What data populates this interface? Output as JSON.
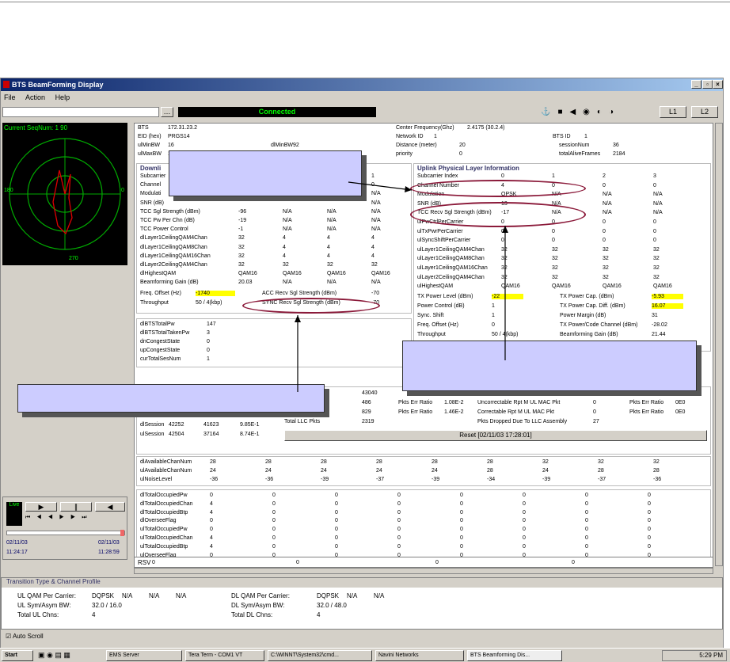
{
  "window": {
    "title": "BTS BeamForming Display",
    "menu": [
      "File",
      "Action",
      "Help"
    ]
  },
  "toolbar": {
    "status": "Connected",
    "l1": "L1",
    "l2": "L2"
  },
  "radar": {
    "seqnum": "Current SeqNum: 1 90",
    "left": "180",
    "right": "0",
    "bottom": "270"
  },
  "header": {
    "bts_label": "BTS",
    "bts": "172.31.23.2",
    "eid_label": "EID (hex)",
    "eid": "PRGS14",
    "ulmin_label": "ulMinBW",
    "ulmin": "16",
    "dlmin_label": "dlMinBW",
    "dlmin": "92",
    "ulmax_label": "ulMaxBW",
    "ulmax": "16",
    "cf_label": "Center Frequency(Ghz)",
    "cf": "2.4175 (30.2.4)",
    "net_label": "Network ID",
    "net": "1",
    "btsid_label": "BTS ID",
    "btsid": "1",
    "dist_label": "Distance (meter)",
    "dist": "20",
    "prio_label": "priority",
    "prio": "0",
    "sess_label": "sessionNum",
    "sess": "36",
    "frames_label": "totalAliveFrames",
    "frames": "2184"
  },
  "downlink": {
    "title": "Downli",
    "rows": [
      {
        "label": "Subcarrier",
        "vals": [
          "",
          "",
          "",
          "1"
        ]
      },
      {
        "label": "Channel",
        "vals": [
          "",
          "",
          "",
          "0"
        ]
      },
      {
        "label": "Modulati",
        "vals": [
          "",
          "",
          "",
          "N/A"
        ]
      },
      {
        "label": "SNR (dB)",
        "vals": [
          "",
          "",
          "",
          "N/A"
        ]
      },
      {
        "label": "TCC Sgl Strength (dBm)",
        "vals": [
          "-96",
          "N/A",
          "N/A",
          "N/A"
        ]
      },
      {
        "label": "TCC Pw Per Chn (dB)",
        "vals": [
          "-19",
          "N/A",
          "N/A",
          "N/A"
        ]
      },
      {
        "label": "TCC Power Control",
        "vals": [
          "-1",
          "N/A",
          "N/A",
          "N/A"
        ]
      },
      {
        "label": "dlLayer1CeilingQAM4Chan",
        "vals": [
          "32",
          "4",
          "4",
          "4"
        ]
      },
      {
        "label": "dlLayer1CeilingQAM8Chan",
        "vals": [
          "32",
          "4",
          "4",
          "4"
        ]
      },
      {
        "label": "dlLayer1CeilingQAM16Chan",
        "vals": [
          "32",
          "4",
          "4",
          "4"
        ]
      },
      {
        "label": "dlLayer2CeilingQAM4Chan",
        "vals": [
          "32",
          "32",
          "32",
          "32"
        ]
      },
      {
        "label": "dlHighestQAM",
        "vals": [
          "QAM16",
          "QAM16",
          "QAM16",
          "QAM16"
        ]
      },
      {
        "label": "Beamforming Gain (dB)",
        "vals": [
          "20.03",
          "N/A",
          "N/A",
          "N/A"
        ]
      }
    ],
    "freq_label": "Freq. Offset (Hz)",
    "freq": "-1740",
    "acc_label": "ACC Recv Sgl Strength (dBm)",
    "acc": "-70",
    "thr_label": "Throughput",
    "thr": "50 / 4(kbp)",
    "sync_label": "SYNC Recv Sgl Strength (dBm)",
    "sync": "-70"
  },
  "uplink": {
    "title": "Uplink Physical Layer Information",
    "rows": [
      {
        "label": "Subcarrier Index",
        "vals": [
          "0",
          "1",
          "2",
          "3"
        ]
      },
      {
        "label": "Channel Number",
        "vals": [
          "4",
          "0",
          "0",
          "0"
        ]
      },
      {
        "label": "Modulation",
        "vals": [
          "QPSK",
          "N/A",
          "N/A",
          "N/A"
        ]
      },
      {
        "label": "SNR (dB)",
        "vals": [
          "13",
          "N/A",
          "N/A",
          "N/A"
        ]
      },
      {
        "label": "TCC Recv Sgl Strength (dBm)",
        "vals": [
          "-17",
          "N/A",
          "N/A",
          "N/A"
        ]
      },
      {
        "label": "ulPwCtrlPerCarrier",
        "vals": [
          "0",
          "0",
          "0",
          "0"
        ]
      },
      {
        "label": "ulTxPwrPerCarrier",
        "vals": [
          "0",
          "0",
          "0",
          "0"
        ]
      },
      {
        "label": "ulSyncShiftPerCarrier",
        "vals": [
          "0",
          "0",
          "0",
          "0"
        ]
      },
      {
        "label": "ulLayer1CeilingQAM4Chan",
        "vals": [
          "32",
          "32",
          "32",
          "32"
        ]
      },
      {
        "label": "ulLayer1CeilingQAM8Chan",
        "vals": [
          "32",
          "32",
          "32",
          "32"
        ]
      },
      {
        "label": "ulLayer1CeilingQAM16Chan",
        "vals": [
          "32",
          "32",
          "32",
          "32"
        ]
      },
      {
        "label": "ulLayer2CeilingQAM4Chan",
        "vals": [
          "32",
          "32",
          "32",
          "32"
        ]
      },
      {
        "label": "ulHighestQAM",
        "vals": [
          "QAM16",
          "QAM16",
          "QAM16",
          "QAM16"
        ]
      }
    ],
    "tx_label": "TX Power Level (dBm)",
    "tx": "-22",
    "txcap_label": "TX Power Cap. (dBm)",
    "txcap": "-5.93",
    "pc_label": "Power Control (dB)",
    "pc": "1",
    "txdiff_label": "TX Power Cap. Diff. (dBm)",
    "txdiff": "16.07",
    "sync_label": "Sync. Shift",
    "sync": "1",
    "pm_label": "Power Margin (dB)",
    "pm": "31",
    "freq_label": "Freq. Offset (Hz)",
    "freq": "0",
    "tpc_label": "TX Power/Code Channel (dBm)",
    "tpc": "-28.02",
    "thr_label": "Throughput",
    "thr": "50 / 4(kbp)",
    "bg_label": "Beamforming Gain (dB)",
    "bg": "21.44"
  },
  "stats": [
    {
      "label": "dlBTSTotalPw",
      "val": "147"
    },
    {
      "label": "dlBTSTotalTakenPw",
      "val": "3"
    },
    {
      "label": "dnCongestState",
      "val": "0"
    },
    {
      "label": "upCongestState",
      "val": "0"
    },
    {
      "label": "curTotalSesNum",
      "val": "1"
    }
  ],
  "mac": {
    "v1": "43040",
    "v2": "486",
    "v3": "829",
    "v4": "2319",
    "pe1_label": "Pkts Err Ratio",
    "pe1": "1.08E-2",
    "pe2_label": "Pkts Err Ratio",
    "pe2": "1.46E-2",
    "un_label": "Uncorrectable Rpt M UL MAC Pkt",
    "un": "0",
    "co_label": "Correctable Rpt M UL MAC Pkt",
    "co": "0",
    "pd_label": "Pkts Dropped Due To LLC Assembly",
    "pd": "27",
    "pe3_label": "Pkts Err Ratio",
    "pe3": "0E0",
    "pe4_label": "Pkts Err Ratio",
    "pe4": "0E0",
    "llc_label": "Total LLC Pkts",
    "dls_label": "dlSession",
    "dls": [
      "42252",
      "41623",
      "9.85E-1"
    ],
    "uls_label": "ulSession",
    "uls": [
      "42504",
      "37164",
      "8.74E-1"
    ],
    "reset": "Reset [02/11/03 17:28:01]"
  },
  "avail": [
    {
      "label": "dlAvailableChanNum",
      "vals": [
        "28",
        "28",
        "28",
        "28",
        "28",
        "28",
        "32",
        "32",
        "32"
      ]
    },
    {
      "label": "ulAvailableChanNum",
      "vals": [
        "24",
        "24",
        "24",
        "24",
        "24",
        "28",
        "24",
        "28",
        "28"
      ]
    },
    {
      "label": "ulNoiseLevel",
      "vals": [
        "-36",
        "-36",
        "-39",
        "-37",
        "-39",
        "-34",
        "-39",
        "-37",
        "-36"
      ]
    }
  ],
  "occ": [
    {
      "label": "dlTotalOccupiedPw",
      "vals": [
        "0",
        "0",
        "0",
        "0",
        "0",
        "0",
        "0",
        "0"
      ]
    },
    {
      "label": "dlTotalOccupiedChan",
      "vals": [
        "4",
        "0",
        "0",
        "0",
        "0",
        "0",
        "0",
        "0"
      ]
    },
    {
      "label": "dlTotalOccupiedBtp",
      "vals": [
        "4",
        "0",
        "0",
        "0",
        "0",
        "0",
        "0",
        "0"
      ]
    },
    {
      "label": "dlOverseeFlag",
      "vals": [
        "0",
        "0",
        "0",
        "0",
        "0",
        "0",
        "0",
        "0"
      ]
    },
    {
      "label": "ulTotalOccupiedPw",
      "vals": [
        "0",
        "0",
        "0",
        "0",
        "0",
        "0",
        "0",
        "0"
      ]
    },
    {
      "label": "ulTotalOccupiedChan",
      "vals": [
        "4",
        "0",
        "0",
        "0",
        "0",
        "0",
        "0",
        "0"
      ]
    },
    {
      "label": "ulTotalOccupiedBtp",
      "vals": [
        "4",
        "0",
        "0",
        "0",
        "0",
        "0",
        "0",
        "0"
      ]
    },
    {
      "label": "ulOverseeFlag",
      "vals": [
        "0",
        "0",
        "0",
        "0",
        "0",
        "0",
        "0",
        "0"
      ]
    }
  ],
  "rsv": {
    "label": "RSV",
    "vals": [
      "0",
      "0",
      "0",
      "0"
    ]
  },
  "playback": {
    "live": "Live",
    "d1": "02/11/03",
    "t1": "11:24:17",
    "d2": "02/11/03",
    "t2": "11:28:59"
  },
  "transition": {
    "title": "Transition Type & Channel Profile",
    "ulqam_label": "UL QAM Per Carrier:",
    "ulqam": [
      "DQPSK",
      "N/A",
      "N/A",
      "N/A"
    ],
    "ulsym_label": "UL Sym/Asym BW:",
    "ulsym": "32.0 / 16.0",
    "ultot_label": "Total UL Chns:",
    "ultot": "4",
    "dlqam_label": "DL QAM Per Carrier:",
    "dlqam": [
      "DQPSK",
      "N/A",
      "N/A"
    ],
    "dlsym_label": "DL Sym/Asym BW:",
    "dlsym": "32.0 / 48.0",
    "dltot_label": "Total DL Chns:",
    "dltot": "4"
  },
  "autoscroll": "Auto Scroll",
  "taskbar": {
    "start": "Start",
    "items": [
      "EMS Server",
      "Tera Term - COM1 VT",
      "C:\\WINNT\\System32\\cmd...",
      "Navini Networks",
      "BTS Beamforming Dis..."
    ],
    "clock": "5:29 PM"
  },
  "colors": {
    "titlebar": "#0a246a",
    "status_green": "#00ff00",
    "highlight": "#ffff00",
    "callout": "#ccccff",
    "oval": "#8b1a3a"
  }
}
